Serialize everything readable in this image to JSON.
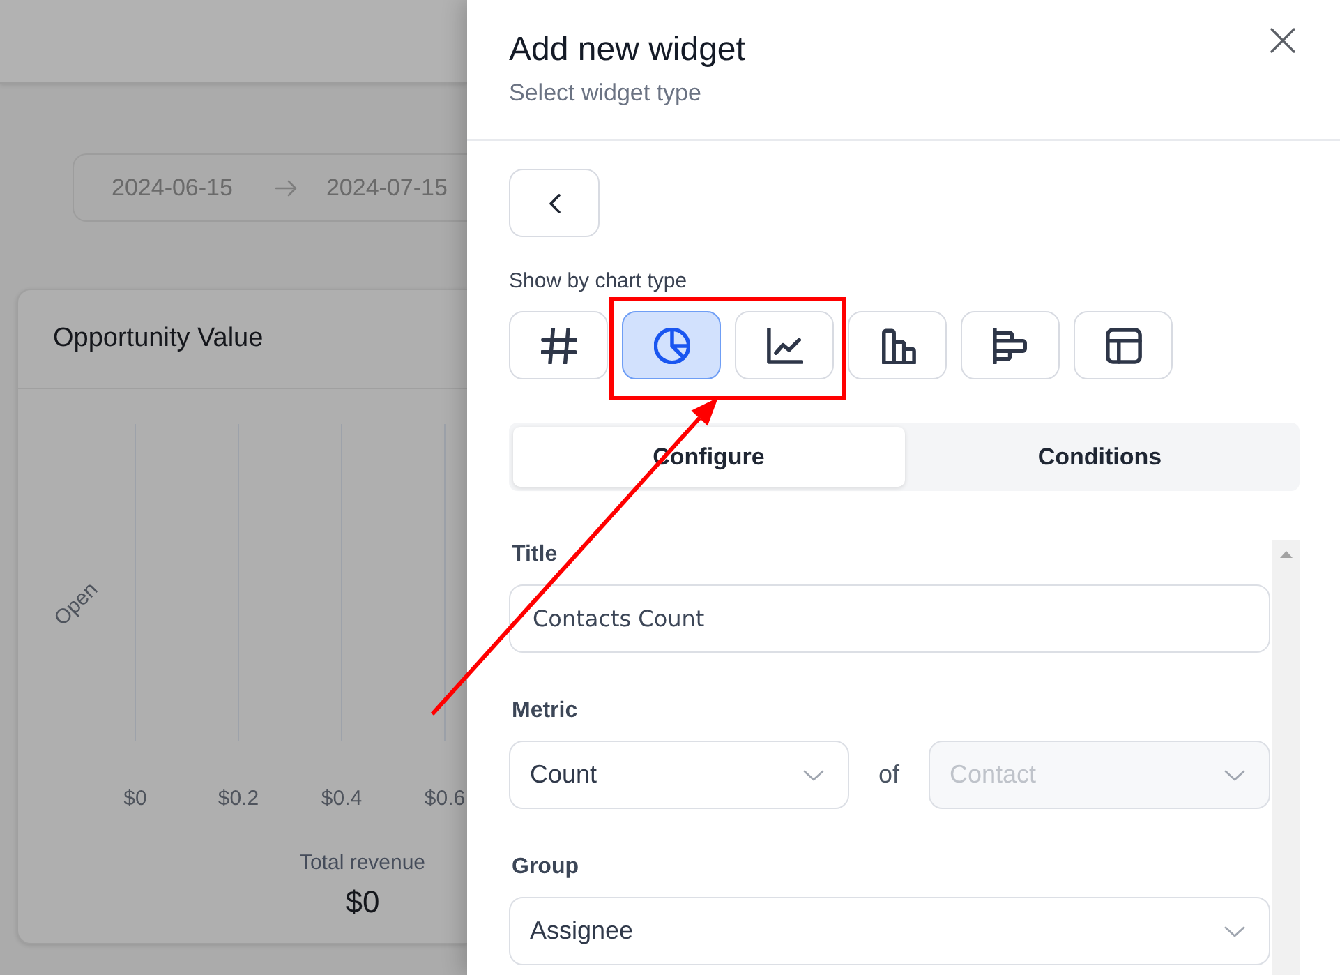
{
  "dashboard": {
    "date_range": {
      "start": "2024-06-15",
      "end": "2024-07-15"
    },
    "card": {
      "title": "Opportunity Value",
      "chart_data": {
        "type": "bar",
        "orientation": "horizontal",
        "categories": [
          "Open"
        ],
        "values": [
          0
        ],
        "xlim": [
          0,
          0.6
        ],
        "xticks": [
          {
            "value": 0,
            "label": "$0"
          },
          {
            "value": 0.2,
            "label": "$0.2"
          },
          {
            "value": 0.4,
            "label": "$0.4"
          },
          {
            "value": 0.6,
            "label": "$0.6"
          }
        ]
      },
      "total_label": "Total revenue",
      "total_value": "$0"
    }
  },
  "drawer": {
    "title": "Add new widget",
    "subtitle": "Select widget type",
    "chart_type_label": "Show by chart type",
    "chart_types": [
      {
        "kind": "number",
        "selected": false
      },
      {
        "kind": "pie",
        "selected": true
      },
      {
        "kind": "line",
        "selected": false
      },
      {
        "kind": "column",
        "selected": false
      },
      {
        "kind": "bar",
        "selected": false
      },
      {
        "kind": "table",
        "selected": false
      }
    ],
    "tabs": [
      {
        "label": "Configure",
        "selected": true
      },
      {
        "label": "Conditions",
        "selected": false
      }
    ],
    "fields": [
      {
        "kind": "text",
        "label": "Title",
        "value": "Contacts Count"
      },
      {
        "kind": "select",
        "label": "Metric",
        "joiner": "of",
        "selects": [
          {
            "value": "Count",
            "disabled": false
          },
          {
            "value": "Contact",
            "disabled": true
          }
        ]
      },
      {
        "kind": "select",
        "label": "Group",
        "selects": [
          {
            "value": "Assignee",
            "disabled": false
          }
        ]
      }
    ]
  }
}
